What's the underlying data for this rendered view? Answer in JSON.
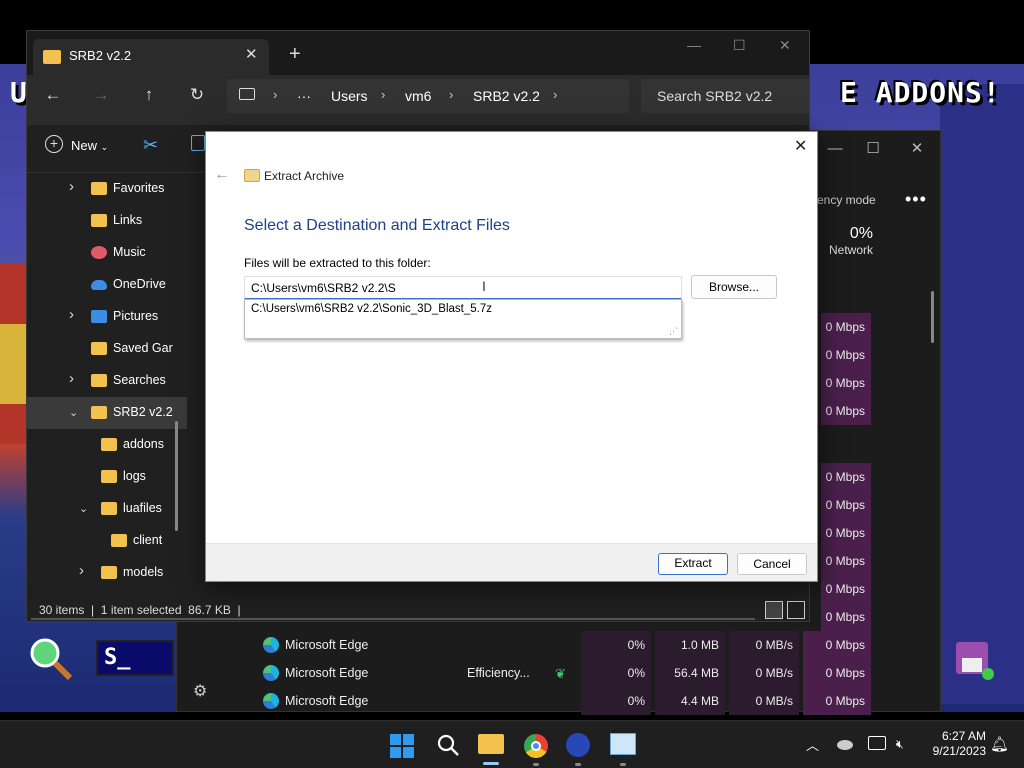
{
  "desktop": {
    "banner_right": "E ADDONS!",
    "banner_left": "U",
    "snap_logo": "S_"
  },
  "explorer": {
    "tab_title": "SRB2 v2.2",
    "breadcrumbs": [
      "Users",
      "vm6",
      "SRB2 v2.2"
    ],
    "search_placeholder": "Search SRB2 v2.2",
    "toolbar": {
      "new_label": "New"
    },
    "sidebar": [
      {
        "label": "Favorites",
        "chevron": ">",
        "icon": "folder-icon"
      },
      {
        "label": "Links",
        "chevron": "",
        "icon": "folder-icon"
      },
      {
        "label": "Music",
        "chevron": "",
        "icon": "music-icon"
      },
      {
        "label": "OneDrive",
        "chevron": "",
        "icon": "cloud-icon"
      },
      {
        "label": "Pictures",
        "chevron": ">",
        "icon": "pictures-icon"
      },
      {
        "label": "Saved Gar",
        "chevron": "",
        "icon": "folder-icon"
      },
      {
        "label": "Searches",
        "chevron": ">",
        "icon": "folder-icon"
      },
      {
        "label": "SRB2 v2.2",
        "chevron": "v",
        "icon": "folder-icon"
      },
      {
        "label": "addons",
        "chevron": "",
        "icon": "folder-icon"
      },
      {
        "label": "logs",
        "chevron": "",
        "icon": "folder-icon"
      },
      {
        "label": "luafiles",
        "chevron": "v",
        "icon": "folder-icon"
      },
      {
        "label": "client",
        "chevron": "",
        "icon": "folder-icon"
      },
      {
        "label": "models",
        "chevron": ">",
        "icon": "folder-icon"
      }
    ],
    "status": "30 items  |  1 item selected  86.7 KB  |"
  },
  "taskmgr": {
    "efficiency_mode_label": "ency mode",
    "network_percent": "0%",
    "network_label": "Network",
    "network_values": [
      "0 Mbps",
      "0 Mbps",
      "0 Mbps",
      "0 Mbps",
      "0 Mbps",
      "0 Mbps",
      "0 Mbps",
      "0 Mbps",
      "0 Mbps",
      "0 Mbps"
    ],
    "rows": [
      {
        "name": "Microsoft Edge",
        "status": "",
        "cpu": "0%",
        "memory": "1.0 MB",
        "disk": "0 MB/s",
        "network": "0 Mbps"
      },
      {
        "name": "Microsoft Edge",
        "status": "Efficiency...",
        "cpu": "0%",
        "memory": "56.4 MB",
        "disk": "0 MB/s",
        "network": "0 Mbps"
      },
      {
        "name": "Microsoft Edge",
        "status": "",
        "cpu": "0%",
        "memory": "4.4 MB",
        "disk": "0 MB/s",
        "network": "0 Mbps"
      }
    ]
  },
  "dialog": {
    "caption": "Extract Archive",
    "heading": "Select a Destination and Extract Files",
    "label": "Files will be extracted to this folder:",
    "path_value": "C:\\Users\\vm6\\SRB2 v2.2\\S",
    "suggestion": "C:\\Users\\vm6\\SRB2 v2.2\\Sonic_3D_Blast_5.7z",
    "browse_label": "Browse...",
    "extract_label": "Extract",
    "cancel_label": "Cancel"
  },
  "taskbar": {
    "time": "6:27 AM",
    "date": "9/21/2023"
  }
}
